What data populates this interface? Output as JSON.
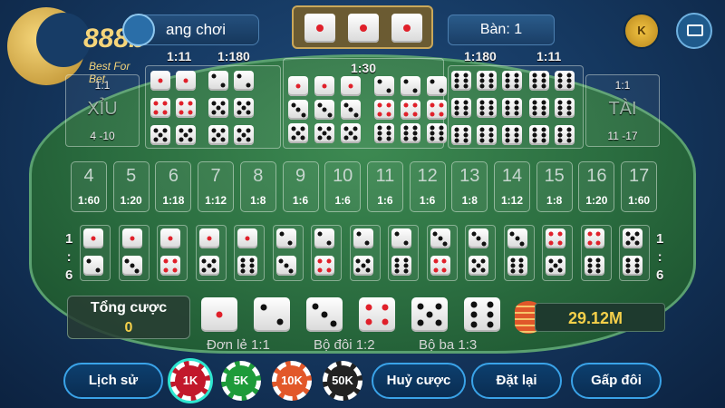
{
  "header": {
    "room_label": "ang chơi",
    "table_label": "Bàn: 1",
    "coin_icon_letter": "K"
  },
  "logo": {
    "brand": "888b",
    "slogan": "Best For Bet"
  },
  "result_dice": [
    1,
    1,
    1
  ],
  "bets": {
    "small": {
      "label": "XỈU",
      "range": "4 -10",
      "odds": "1:1"
    },
    "big": {
      "label": "TÀI",
      "range": "11 -17",
      "odds": "1:1"
    },
    "triple_odds_left": "1:180",
    "triple_odds_right": "1:180",
    "any_triple_odds": "1:30",
    "small_side_top": "1:1",
    "small_side_top_right": "1:11",
    "big_side_top": "1:11",
    "totals": [
      {
        "n": "4",
        "o": "1:60"
      },
      {
        "n": "5",
        "o": "1:20"
      },
      {
        "n": "6",
        "o": "1:18"
      },
      {
        "n": "7",
        "o": "1:12"
      },
      {
        "n": "8",
        "o": "1:8"
      },
      {
        "n": "9",
        "o": "1:6"
      },
      {
        "n": "10",
        "o": "1:6"
      },
      {
        "n": "11",
        "o": "1:6"
      },
      {
        "n": "12",
        "o": "1:6"
      },
      {
        "n": "13",
        "o": "1:8"
      },
      {
        "n": "14",
        "o": "1:12"
      },
      {
        "n": "15",
        "o": "1:8"
      },
      {
        "n": "16",
        "o": "1:20"
      },
      {
        "n": "17",
        "o": "1:60"
      }
    ],
    "combo_odds_left_1": "1",
    "combo_odds_left_sep": ":",
    "combo_odds_left_2": "6",
    "combo_odds_right_1": "1",
    "combo_odds_right_sep": ":",
    "combo_odds_right_2": "6"
  },
  "total_bet": {
    "label": "Tổng cược",
    "value": "0"
  },
  "single_dice": [
    1,
    2,
    3,
    4,
    5,
    6
  ],
  "balance": "29.12M",
  "rules": {
    "single": "Đơn lẻ 1:1",
    "pair": "Bộ đôi 1:2",
    "triple": "Bộ ba 1:3"
  },
  "buttons": {
    "history": "Lịch sử",
    "cancel": "Huỷ cược",
    "reset": "Đặt lại",
    "double": "Gấp đôi"
  },
  "chips": [
    {
      "label": "1K",
      "color": "#c2182b"
    },
    {
      "label": "5K",
      "color": "#1e9b3a"
    },
    {
      "label": "10K",
      "color": "#e2582a"
    },
    {
      "label": "50K",
      "color": "#222222"
    }
  ]
}
